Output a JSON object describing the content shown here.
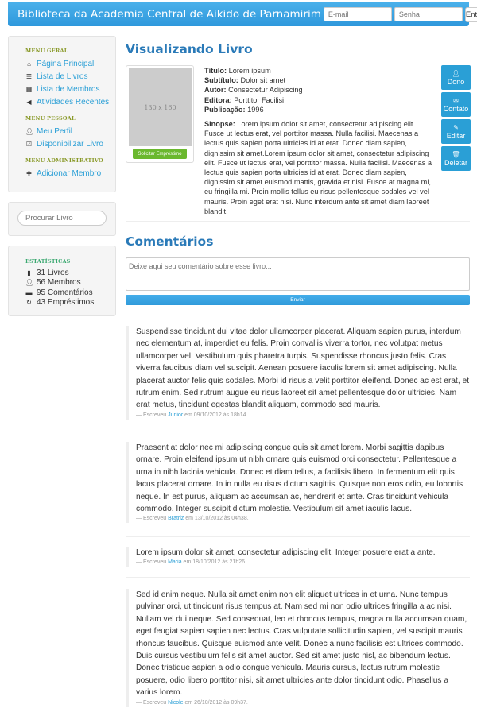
{
  "header": {
    "brand": "Biblioteca da Academia Central de Aikido de Parnamirim",
    "email_placeholder": "E-mail",
    "password_placeholder": "Senha",
    "login_label": "Entrar"
  },
  "sidebar": {
    "general_title": "Menu Geral",
    "general": [
      {
        "icon": "home-icon",
        "label": "Página Principal"
      },
      {
        "icon": "list-icon",
        "label": "Lista de Livros"
      },
      {
        "icon": "grid-icon",
        "label": "Lista de Membros"
      },
      {
        "icon": "bullhorn-icon",
        "label": "Atividades Recentes"
      }
    ],
    "personal_title": "Menu Pessoal",
    "personal": [
      {
        "icon": "user-icon",
        "label": "Meu Perfil"
      },
      {
        "icon": "check-icon",
        "label": "Disponibilizar Livro"
      }
    ],
    "admin_title": "Menu Administrativo",
    "admin": [
      {
        "icon": "plus-icon",
        "label": "Adicionar Membro"
      }
    ],
    "search_placeholder": "Procurar Livro",
    "stats_title": "Estatísticas",
    "stats": [
      {
        "icon": "book-icon",
        "label": "31 Livros"
      },
      {
        "icon": "user-icon",
        "label": "56 Membros"
      },
      {
        "icon": "comment-icon",
        "label": "95 Comentários"
      },
      {
        "icon": "refresh-icon",
        "label": "43 Empréstimos"
      }
    ]
  },
  "book": {
    "page_title": "Visualizando Livro",
    "cover_placeholder": "130 x 160",
    "loan_label": "Solicitar Empréstimo",
    "fields": [
      {
        "label": "Título:",
        "value": "Lorem ipsum"
      },
      {
        "label": "Subtítulo:",
        "value": "Dolor sit amet"
      },
      {
        "label": "Autor:",
        "value": "Consectetur Adipiscing"
      },
      {
        "label": "Editora:",
        "value": "Porttitor Facilisi"
      },
      {
        "label": "Publicação:",
        "value": "1996"
      }
    ],
    "synopsis_label": "Sinopse:",
    "synopsis": "Lorem ipsum dolor sit amet, consectetur adipiscing elit. Fusce ut lectus erat, vel porttitor massa. Nulla facilisi. Maecenas a lectus quis sapien porta ultricies id at erat. Donec diam sapien, dignissim sit amet.Lorem ipsum dolor sit amet, consectetur adipiscing elit. Fusce ut lectus erat, vel porttitor massa. Nulla facilisi. Maecenas a lectus quis sapien porta ultricies id at erat. Donec diam sapien, dignissim sit amet euismod mattis, gravida et nisi. Fusce at magna mi, eu fringilla mi. Proin mollis tellus eu risus pellentesque sodales vel vel mauris. Proin eget erat nisi. Nunc interdum ante sit amet diam laoreet blandit.",
    "actions": [
      {
        "icon": "user-icon",
        "label": "Dono"
      },
      {
        "icon": "envelope-icon",
        "label": "Contato"
      },
      {
        "icon": "pencil-icon",
        "label": "Editar"
      },
      {
        "icon": "trash-icon",
        "label": "Deletar"
      }
    ]
  },
  "comments": {
    "title": "Comentários",
    "placeholder": "Deixe aqui seu comentário sobre esse livro...",
    "send_label": "Enviar",
    "items": [
      {
        "text": "Suspendisse tincidunt dui vitae dolor ullamcorper placerat. Aliquam sapien purus, interdum nec elementum at, imperdiet eu felis. Proin convallis viverra tortor, nec volutpat metus ullamcorper vel. Vestibulum quis pharetra turpis. Suspendisse rhoncus justo felis. Cras viverra faucibus diam vel suscipit. Aenean posuere iaculis lorem sit amet adipiscing. Nulla placerat auctor felis quis sodales. Morbi id risus a velit porttitor eleifend. Donec ac est erat, et rutrum enim. Sed rutrum augue eu risus laoreet sit amet pellentesque dolor ultricies. Nam erat metus, tincidunt egestas blandit aliquam, commodo sed mauris.",
        "prefix": "— Escreveu",
        "author": "Junior",
        "date": "em 09/10/2012 às 18h14."
      },
      {
        "text": "Praesent at dolor nec mi adipiscing congue quis sit amet lorem. Morbi sagittis dapibus ornare. Proin eleifend ipsum ut nibh ornare quis euismod orci consectetur. Pellentesque a urna in nibh lacinia vehicula. Donec et diam tellus, a facilisis libero. In fermentum elit quis lacus placerat ornare. In in nulla eu risus dictum sagittis. Quisque non eros odio, eu lobortis neque. In est purus, aliquam ac accumsan ac, hendrerit et ante. Cras tincidunt vehicula commodo. Integer suscipit dictum molestie. Vestibulum sit amet iaculis lacus.",
        "prefix": "— Escreveu",
        "author": "Bratriz",
        "date": "em 13/10/2012 às 04h38."
      },
      {
        "text": "Lorem ipsum dolor sit amet, consectetur adipiscing elit. Integer posuere erat a ante.",
        "prefix": "— Escreveu",
        "author": "Maria",
        "date": "em 18/10/2012 às 21h26."
      },
      {
        "text": "Sed id enim neque. Nulla sit amet enim non elit aliquet ultrices in et urna. Nunc tempus pulvinar orci, ut tincidunt risus tempus at. Nam sed mi non odio ultrices fringilla a ac nisi. Nullam vel dui neque. Sed consequat, leo et rhoncus tempus, magna nulla accumsan quam, eget feugiat sapien sapien nec lectus. Cras vulputate sollicitudin sapien, vel suscipit mauris rhoncus faucibus. Quisque euismod ante velit. Donec a nunc facilisis est ultrices commodo. Duis cursus vestibulum felis sit amet auctor. Sed sit amet justo nisl, ac bibendum lectus. Donec tristique sapien a odio congue vehicula. Mauris cursus, lectus rutrum molestie posuere, odio libero porttitor nisi, sit amet ultricies ante dolor tincidunt odio. Phasellus a varius lorem.",
        "prefix": "— Escreveu",
        "author": "Nicole",
        "date": "em 26/10/2012 às 09h37."
      }
    ]
  }
}
